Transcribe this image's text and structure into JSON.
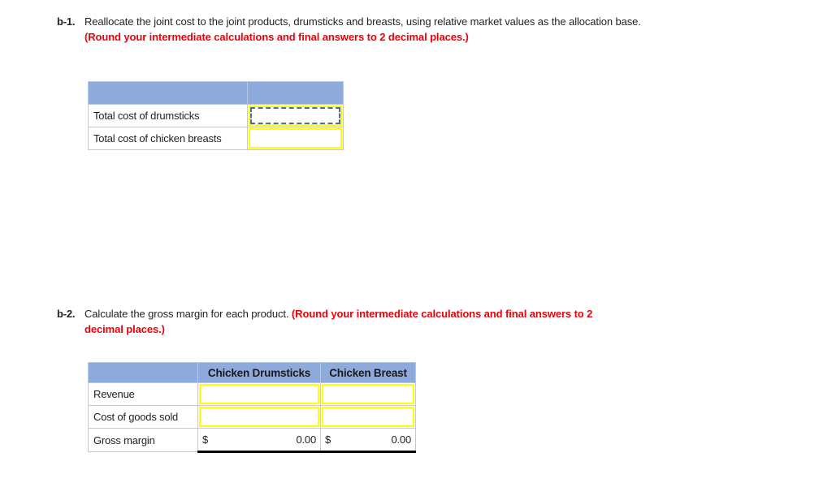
{
  "questions": [
    {
      "number": "b-1.",
      "text_plain_1": "Reallocate the joint cost to the joint products, drumsticks and breasts, using relative market values as the allocation base. ",
      "text_emphasis": "(Round your intermediate calculations and final answers to 2 decimal places.)"
    },
    {
      "number": "b-2.",
      "text_plain_1": "Calculate the gross margin for each product. ",
      "text_emphasis": "(Round your intermediate calculations and final answers to 2 decimal places.)"
    }
  ],
  "table_b1": {
    "header": [
      "",
      ""
    ],
    "rows": [
      {
        "label": "Total cost of drumsticks",
        "value": "",
        "selected": true
      },
      {
        "label": "Total cost of chicken breasts",
        "value": "",
        "selected": false
      }
    ]
  },
  "table_b2": {
    "header": [
      "",
      "Chicken Drumsticks",
      "Chicken Breast"
    ],
    "rows": [
      {
        "label": "Revenue",
        "drumsticks": "",
        "breast": "",
        "type": "input"
      },
      {
        "label": "Cost of goods sold",
        "drumsticks": "",
        "breast": "",
        "type": "input"
      },
      {
        "label": "Gross margin",
        "drumsticks_currency": "$",
        "drumsticks": "0.00",
        "breast_currency": "$",
        "breast": "0.00",
        "type": "total"
      }
    ]
  },
  "colors": {
    "header_blue": "#8faadc",
    "emphasis_red": "#ee0008",
    "input_yellow": "#ffff00",
    "selection_dash": "#4a6fa5",
    "grid_gray": "#c8c8c8"
  }
}
